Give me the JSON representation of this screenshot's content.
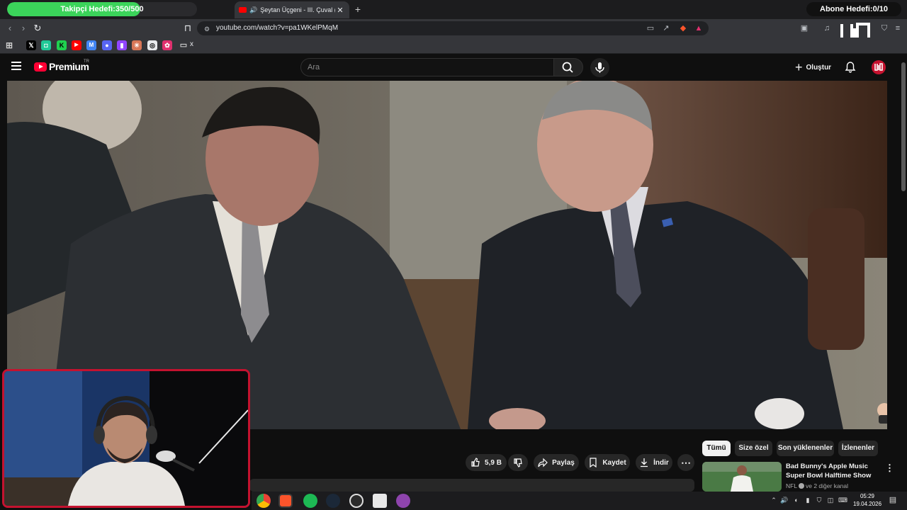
{
  "overlay": {
    "follower_goal_label": "Takipçi Hedefi:350/500",
    "follower_goal_progress": 0.7,
    "subscriber_goal_label": "Abone Hedefi:0/10"
  },
  "browser": {
    "tab_title": "Şeytan Üçgeni - III. Çuval (EX",
    "url": "youtube.com/watch?v=pa1WKelPMqM",
    "bookmark_folder_label": "x",
    "bookmarks": [
      "x-icon",
      "green-app-icon",
      "kick-icon",
      "youtube-icon",
      "gmail-icon",
      "discord-icon",
      "twitch-icon",
      "claude-icon",
      "chatgpt-icon",
      "red-app-icon",
      "folder-icon"
    ]
  },
  "youtube": {
    "brand": "Premium",
    "region": "TR",
    "search_placeholder": "Ara",
    "create_label": "Oluştur"
  },
  "actions": {
    "like_count": "5,9 B",
    "share_label": "Paylaş",
    "save_label": "Kaydet",
    "download_label": "İndir"
  },
  "chips": [
    "Tümü",
    "Size özel",
    "Son yüklenenler",
    "İzlenenler"
  ],
  "recommendation": {
    "title": "Bad Bunny's Apple Music Super Bowl Halftime Show",
    "channel": "NFL",
    "channel_suffix": "ve 2 diğer kanal"
  },
  "taskbar": {
    "time": "05:29",
    "date": "19.04.2026"
  }
}
